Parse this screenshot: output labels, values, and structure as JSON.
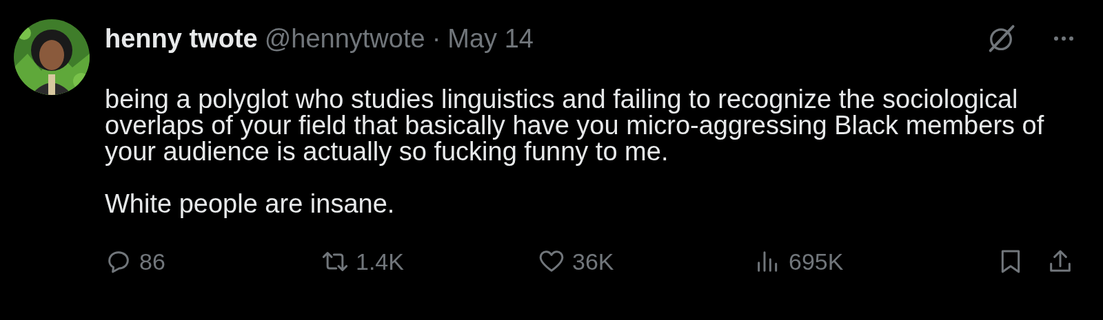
{
  "tweet": {
    "author": {
      "name": "henny twote",
      "handle": "@hennytwote"
    },
    "separator": "·",
    "date": "May 14",
    "paragraphs": [
      "being a polyglot who studies linguistics and failing to recognize the sociological overlaps of your field that basically have you micro-aggressing Black members of your audience is actually so fucking funny to me.",
      "White people are insane."
    ],
    "actions": [
      {
        "kind": "reply",
        "count": "86"
      },
      {
        "kind": "repost",
        "count": "1.4K"
      },
      {
        "kind": "like",
        "count": "36K"
      },
      {
        "kind": "views",
        "count": "695K"
      }
    ]
  }
}
